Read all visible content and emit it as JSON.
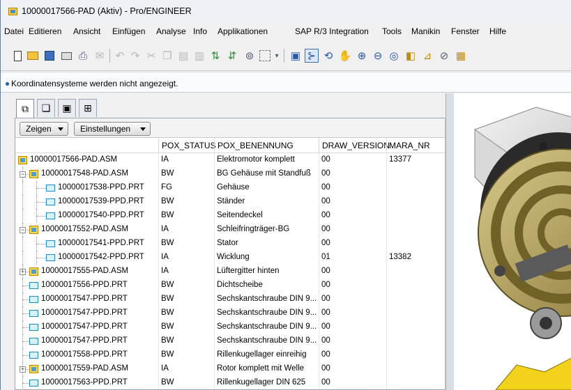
{
  "window": {
    "title": "10000017566-PAD (Aktiv) - Pro/ENGINEER"
  },
  "menu": [
    "Datei",
    "Editieren",
    "Ansicht",
    "Einfügen",
    "Analyse",
    "Info",
    "Applikationen",
    "SAP R/3 Integration",
    "Tools",
    "Manikin",
    "Fenster",
    "Hilfe"
  ],
  "toolbar": {
    "icons": [
      "new-icon",
      "open-icon",
      "save-icon",
      "print-icon",
      "send-icon",
      "mail-icon",
      "undo-icon",
      "redo-icon",
      "cut-icon",
      "copy-icon",
      "paste-icon",
      "paste-special-icon",
      "regenerate-icon",
      "regenerate-manager-icon",
      "find-icon",
      "select-box-icon",
      "select-dropdown-icon",
      "repaint-icon",
      "spin-center-icon",
      "orient-icon",
      "pan-icon",
      "zoom-in-icon",
      "zoom-out-icon",
      "refit-icon",
      "datum-planes-icon",
      "datum-axes-icon",
      "datum-points-icon",
      "csys-icon"
    ]
  },
  "message": "Koordinatensysteme werden nicht angezeigt.",
  "navigator": {
    "tabs": [
      "model-tree-icon",
      "folder-browser-icon",
      "favorites-icon",
      "connections-icon"
    ],
    "buttons": {
      "show": "Zeigen",
      "settings": "Einstellungen"
    },
    "columns": [
      "POX_STATUS",
      "POX_BENENNUNG",
      "DRAW_VERSION",
      "MARA_NR"
    ],
    "rows": [
      {
        "name": "10000017566-PAD.ASM",
        "type": "asm",
        "level": 0,
        "expander": "",
        "status": "IA",
        "benennung": "Elektromotor komplett",
        "version": "00",
        "mara": "13377"
      },
      {
        "name": "10000017548-PAD.ASM",
        "type": "asm",
        "level": 1,
        "expander": "−",
        "status": "BW",
        "benennung": "BG Gehäuse mit Standfuß",
        "version": "00",
        "mara": ""
      },
      {
        "name": "10000017538-PPD.PRT",
        "type": "prt",
        "level": 2,
        "expander": "",
        "status": "FG",
        "benennung": "Gehäuse",
        "version": "00",
        "mara": ""
      },
      {
        "name": "10000017539-PPD.PRT",
        "type": "prt",
        "level": 2,
        "expander": "",
        "status": "BW",
        "benennung": "Ständer",
        "version": "00",
        "mara": ""
      },
      {
        "name": "10000017540-PPD.PRT",
        "type": "prt",
        "level": 2,
        "expander": "",
        "status": "BW",
        "benennung": "Seitendeckel",
        "version": "00",
        "mara": ""
      },
      {
        "name": "10000017552-PAD.ASM",
        "type": "asm",
        "level": 1,
        "expander": "−",
        "status": "IA",
        "benennung": "Schleifringträger-BG",
        "version": "00",
        "mara": ""
      },
      {
        "name": "10000017541-PPD.PRT",
        "type": "prt",
        "level": 2,
        "expander": "",
        "status": "BW",
        "benennung": "Stator",
        "version": "00",
        "mara": ""
      },
      {
        "name": "10000017542-PPD.PRT",
        "type": "prt",
        "level": 2,
        "expander": "",
        "status": "IA",
        "benennung": "Wicklung",
        "version": "01",
        "mara": "13382"
      },
      {
        "name": "10000017555-PAD.ASM",
        "type": "asm",
        "level": 1,
        "expander": "+",
        "status": "IA",
        "benennung": "Lüftergitter hinten",
        "version": "00",
        "mara": ""
      },
      {
        "name": "10000017556-PPD.PRT",
        "type": "prt",
        "level": 1,
        "expander": "",
        "status": "BW",
        "benennung": "Dichtscheibe",
        "version": "00",
        "mara": ""
      },
      {
        "name": "10000017547-PPD.PRT",
        "type": "prt",
        "level": 1,
        "expander": "",
        "status": "BW",
        "benennung": "Sechskantschraube DIN 9...",
        "version": "00",
        "mara": ""
      },
      {
        "name": "10000017547-PPD.PRT",
        "type": "prt",
        "level": 1,
        "expander": "",
        "status": "BW",
        "benennung": "Sechskantschraube DIN 9...",
        "version": "00",
        "mara": ""
      },
      {
        "name": "10000017547-PPD.PRT",
        "type": "prt",
        "level": 1,
        "expander": "",
        "status": "BW",
        "benennung": "Sechskantschraube DIN 9...",
        "version": "00",
        "mara": ""
      },
      {
        "name": "10000017547-PPD.PRT",
        "type": "prt",
        "level": 1,
        "expander": "",
        "status": "BW",
        "benennung": "Sechskantschraube DIN 9...",
        "version": "00",
        "mara": ""
      },
      {
        "name": "10000017558-PPD.PRT",
        "type": "prt",
        "level": 1,
        "expander": "",
        "status": "BW",
        "benennung": "Rillenkugellager einreihig",
        "version": "00",
        "mara": ""
      },
      {
        "name": "10000017559-PAD.ASM",
        "type": "asm",
        "level": 1,
        "expander": "+",
        "status": "IA",
        "benennung": "Rotor komplett mit Welle",
        "version": "00",
        "mara": ""
      },
      {
        "name": "10000017563-PPD.PRT",
        "type": "prt",
        "level": 1,
        "expander": "",
        "status": "BW",
        "benennung": "Rillenkugellager DIN 625",
        "version": "00",
        "mara": ""
      }
    ]
  },
  "colors": {
    "accent": "#1e5bc6",
    "assembly_icon": "#ffd84a",
    "part_icon": "#1f8ad1"
  }
}
